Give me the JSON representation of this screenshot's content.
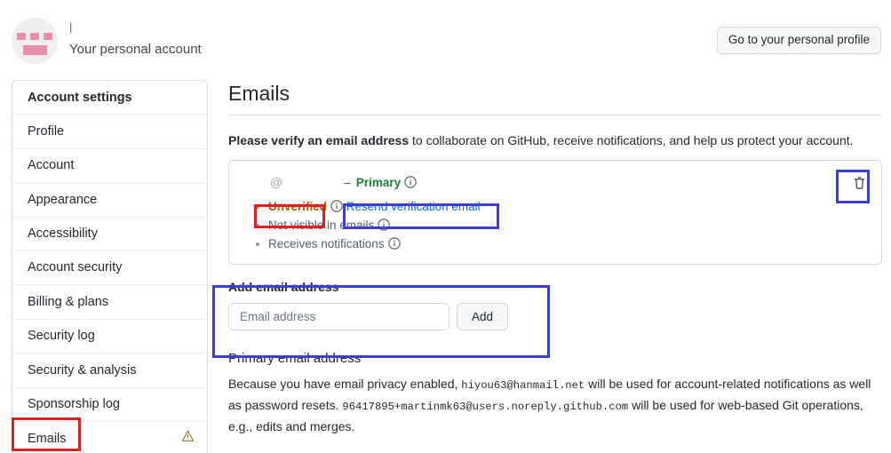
{
  "header": {
    "account_name": "|",
    "account_subtitle": "Your personal account",
    "profile_button": "Go to your personal profile"
  },
  "sidebar": {
    "items": [
      {
        "label": "Account settings",
        "is_header": true,
        "warning": false
      },
      {
        "label": "Profile",
        "is_header": false,
        "warning": false
      },
      {
        "label": "Account",
        "is_header": false,
        "warning": false
      },
      {
        "label": "Appearance",
        "is_header": false,
        "warning": false
      },
      {
        "label": "Accessibility",
        "is_header": false,
        "warning": false
      },
      {
        "label": "Account security",
        "is_header": false,
        "warning": false
      },
      {
        "label": "Billing & plans",
        "is_header": false,
        "warning": false
      },
      {
        "label": "Security log",
        "is_header": false,
        "warning": false
      },
      {
        "label": "Security & analysis",
        "is_header": false,
        "warning": false
      },
      {
        "label": "Sponsorship log",
        "is_header": false,
        "warning": false
      },
      {
        "label": "Emails",
        "is_header": false,
        "warning": true
      }
    ]
  },
  "main": {
    "page_title": "Emails",
    "verify_notice_bold": "Please verify an email address",
    "verify_notice_rest": " to collaborate on GitHub, receive notifications, and help us protect your account.",
    "email_row": {
      "address_redacted": "@",
      "dash": "–",
      "primary_label": "Primary",
      "flags": [
        {
          "type": "unverified",
          "label": "Unverified",
          "link": "Resend verification email"
        },
        {
          "type": "plain",
          "label": "Not visible in emails"
        },
        {
          "type": "plain",
          "label": "Receives notifications"
        }
      ]
    },
    "add_email": {
      "title": "Add email address",
      "input_value": "",
      "input_placeholder": "Email address",
      "add_button": "Add"
    },
    "primary_email": {
      "title": "Primary email address",
      "text_1": "Because you have email privacy enabled, ",
      "email_1": "hiyou63@hanmail.net",
      "text_2": " will be used for account-related notifications as well as password resets. ",
      "email_2": "96417895+martinmk63@users.noreply.github.com",
      "text_3": " will be used for web-based Git operations, e.g., edits and merges."
    }
  },
  "colors": {
    "annotation_red": "#e02020",
    "annotation_blue": "#3b3fd8",
    "primary_green": "#1a7f37",
    "unverified_amber": "#9a6700",
    "link_blue": "#0969da"
  }
}
